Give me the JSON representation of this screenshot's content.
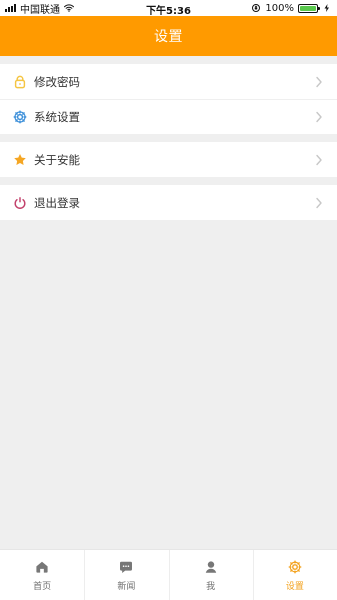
{
  "status_bar": {
    "carrier": "中国联通",
    "time": "下午5:36",
    "battery_percent": "100%",
    "battery_level": 1.0
  },
  "header": {
    "title": "设置"
  },
  "settings": {
    "groups": [
      {
        "items": [
          {
            "label": "修改密码",
            "icon": "lock-icon"
          },
          {
            "label": "系统设置",
            "icon": "gear-icon"
          }
        ]
      },
      {
        "items": [
          {
            "label": "关于安能",
            "icon": "star-icon"
          }
        ]
      },
      {
        "items": [
          {
            "label": "退出登录",
            "icon": "power-icon"
          }
        ]
      }
    ]
  },
  "tabbar": {
    "items": [
      {
        "label": "首页",
        "icon": "home-icon",
        "active": false
      },
      {
        "label": "新闻",
        "icon": "chat-icon",
        "active": false
      },
      {
        "label": "我",
        "icon": "user-icon",
        "active": false
      },
      {
        "label": "设置",
        "icon": "settings-icon",
        "active": true
      }
    ]
  },
  "colors": {
    "accent": "#ff9a00",
    "active_tab": "#f3a11b",
    "background": "#efefef",
    "lock_icon": "#f5c542",
    "gear_icon": "#3c8fd9",
    "star_icon": "#f5a623",
    "power_icon": "#c2416b",
    "battery": "#59c94d"
  }
}
